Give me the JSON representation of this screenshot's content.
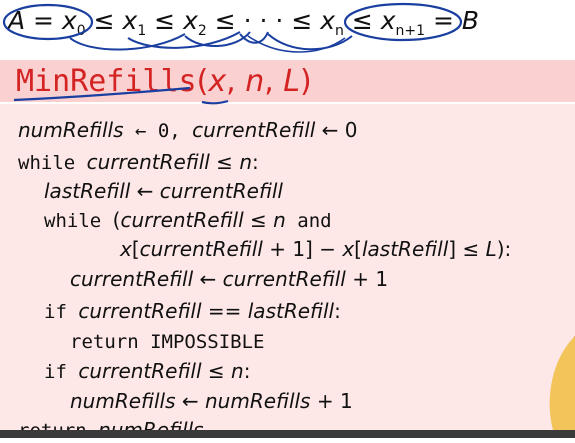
{
  "top_line": {
    "A": "A",
    "eq1": " = ",
    "x": "x",
    "sub0": "0",
    "le": " ≤ ",
    "sub1": "1",
    "sub2": "2",
    "dots": "· · ·",
    "subn": "n",
    "subn1": "n+1",
    "eq2": " = ",
    "B": "B"
  },
  "title": {
    "name": "MinRefills",
    "open": "(",
    "x": "x",
    "comma1": ", ",
    "n": "n",
    "comma2": ", ",
    "L": "L",
    "close": ")"
  },
  "code": {
    "l1": {
      "a": "numRefills",
      "b": " ← 0, ",
      "c": "currentRefill",
      "d": " ← 0"
    },
    "l2": {
      "kw": "while ",
      "a": "currentRefill",
      "b": " ≤ ",
      "c": "n",
      "d": ":"
    },
    "l3": {
      "a": "lastRefill",
      "b": " ← ",
      "c": "currentRefill"
    },
    "l4": {
      "kw": "while ",
      "p": "(",
      "a": "currentRefill",
      "b": " ≤ ",
      "c": "n",
      "kw2": " and"
    },
    "l5": {
      "a": "x",
      "b": "[",
      "c": "currentRefill",
      "d": " + 1] − ",
      "e": "x",
      "f": "[",
      "g": "lastRefill",
      "h": "] ≤ ",
      "i": "L",
      "j": "):"
    },
    "l6": {
      "a": "currentRefill",
      "b": " ← ",
      "c": "currentRefill",
      "d": " + 1"
    },
    "l7": {
      "kw": "if ",
      "a": "currentRefill",
      "b": " == ",
      "c": "lastRefill",
      "d": ":"
    },
    "l8": {
      "kw": "return IMPOSSIBLE"
    },
    "l9": {
      "kw": "if ",
      "a": "currentRefill",
      "b": " ≤ ",
      "c": "n",
      "d": ":"
    },
    "l10": {
      "a": "numRefills",
      "b": " ← ",
      "c": "numRefills",
      "d": " + 1"
    },
    "l11": {
      "kw": "return ",
      "a": "numRefills"
    }
  },
  "colors": {
    "title_red": "#d32323",
    "title_band": "#fbd0d0",
    "body_band": "#fde7e7",
    "annotation_ink": "#1a3fa0"
  }
}
